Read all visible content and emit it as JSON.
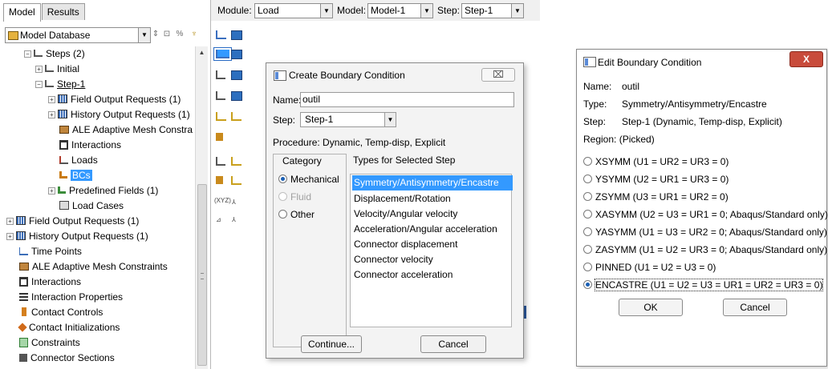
{
  "left": {
    "tabs": [
      "Model",
      "Results"
    ],
    "db_label": "Model Database",
    "tree": [
      {
        "label": "Steps (2)",
        "icon": "steps-icon"
      },
      {
        "label": "Initial",
        "icon": "step-icon"
      },
      {
        "label": "Step-1",
        "icon": "step-icon"
      },
      {
        "label": "Field Output Requests (1)",
        "icon": "output-request-icon"
      },
      {
        "label": "History Output Requests (1)",
        "icon": "output-request-icon"
      },
      {
        "label": "ALE Adaptive Mesh Constrai",
        "icon": "ale-icon"
      },
      {
        "label": "Interactions",
        "icon": "interaction-icon"
      },
      {
        "label": "Loads",
        "icon": "load-icon"
      },
      {
        "label": "BCs",
        "icon": "bc-icon"
      },
      {
        "label": "Predefined Fields (1)",
        "icon": "predefined-field-icon"
      },
      {
        "label": "Load Cases",
        "icon": "load-case-icon"
      },
      {
        "label": "Field Output Requests (1)",
        "icon": "output-request-icon"
      },
      {
        "label": "History Output Requests (1)",
        "icon": "output-request-icon"
      },
      {
        "label": "Time Points",
        "icon": "time-points-icon"
      },
      {
        "label": "ALE Adaptive Mesh Constraints",
        "icon": "ale-icon"
      },
      {
        "label": "Interactions",
        "icon": "interaction-icon"
      },
      {
        "label": "Interaction Properties",
        "icon": "interaction-property-icon"
      },
      {
        "label": "Contact Controls",
        "icon": "contact-control-icon"
      },
      {
        "label": "Contact Initializations",
        "icon": "contact-init-icon"
      },
      {
        "label": "Constraints",
        "icon": "constraint-icon"
      },
      {
        "label": "Connector Sections",
        "icon": "connector-section-icon"
      }
    ]
  },
  "module_bar": {
    "module_label": "Module:",
    "module_value": "Load",
    "model_label": "Model:",
    "model_value": "Model-1",
    "step_label": "Step:",
    "step_value": "Step-1"
  },
  "create_dialog": {
    "title": "Create Boundary Condition",
    "name_label": "Name:",
    "name_value": "outil",
    "step_label": "Step:",
    "step_value": "Step-1",
    "procedure": "Procedure: Dynamic, Temp-disp, Explicit",
    "category_header": "Category",
    "types_header": "Types for Selected Step",
    "categories": [
      "Mechanical",
      "Fluid",
      "Other"
    ],
    "types": [
      "Symmetry/Antisymmetry/Encastre",
      "Displacement/Rotation",
      "Velocity/Angular velocity",
      "Acceleration/Angular acceleration",
      "Connector displacement",
      "Connector velocity",
      "Connector acceleration"
    ],
    "continue_label": "Continue...",
    "cancel_label": "Cancel"
  },
  "edit_dialog": {
    "title": "Edit Boundary Condition",
    "close_label": "X",
    "name_label": "Name:",
    "name_value": "outil",
    "type_label": "Type:",
    "type_value": "Symmetry/Antisymmetry/Encastre",
    "step_label": "Step:",
    "step_value": "Step-1 (Dynamic, Temp-disp, Explicit)",
    "region_label": "Region:",
    "region_value": "(Picked)",
    "options": [
      "XSYMM (U1 = UR2 = UR3 = 0)",
      "YSYMM (U2 = UR1 = UR3 = 0)",
      "ZSYMM (U3 = UR1 = UR2 = 0)",
      "XASYMM (U2 = U3 = UR1 = 0; Abaqus/Standard only)",
      "YASYMM (U1 = U3 = UR2 = 0; Abaqus/Standard only)",
      "ZASYMM (U1 = U2 = UR3 = 0; Abaqus/Standard only)",
      "PINNED (U1 = U2 = U3 = 0)",
      "ENCASTRE (U1 = U2 = U3 = UR1 = UR2 = UR3 = 0)"
    ],
    "ok_label": "OK",
    "cancel_label": "Cancel"
  },
  "colors": {
    "selection": "#3399ff",
    "close_button": "#c84b3b"
  }
}
